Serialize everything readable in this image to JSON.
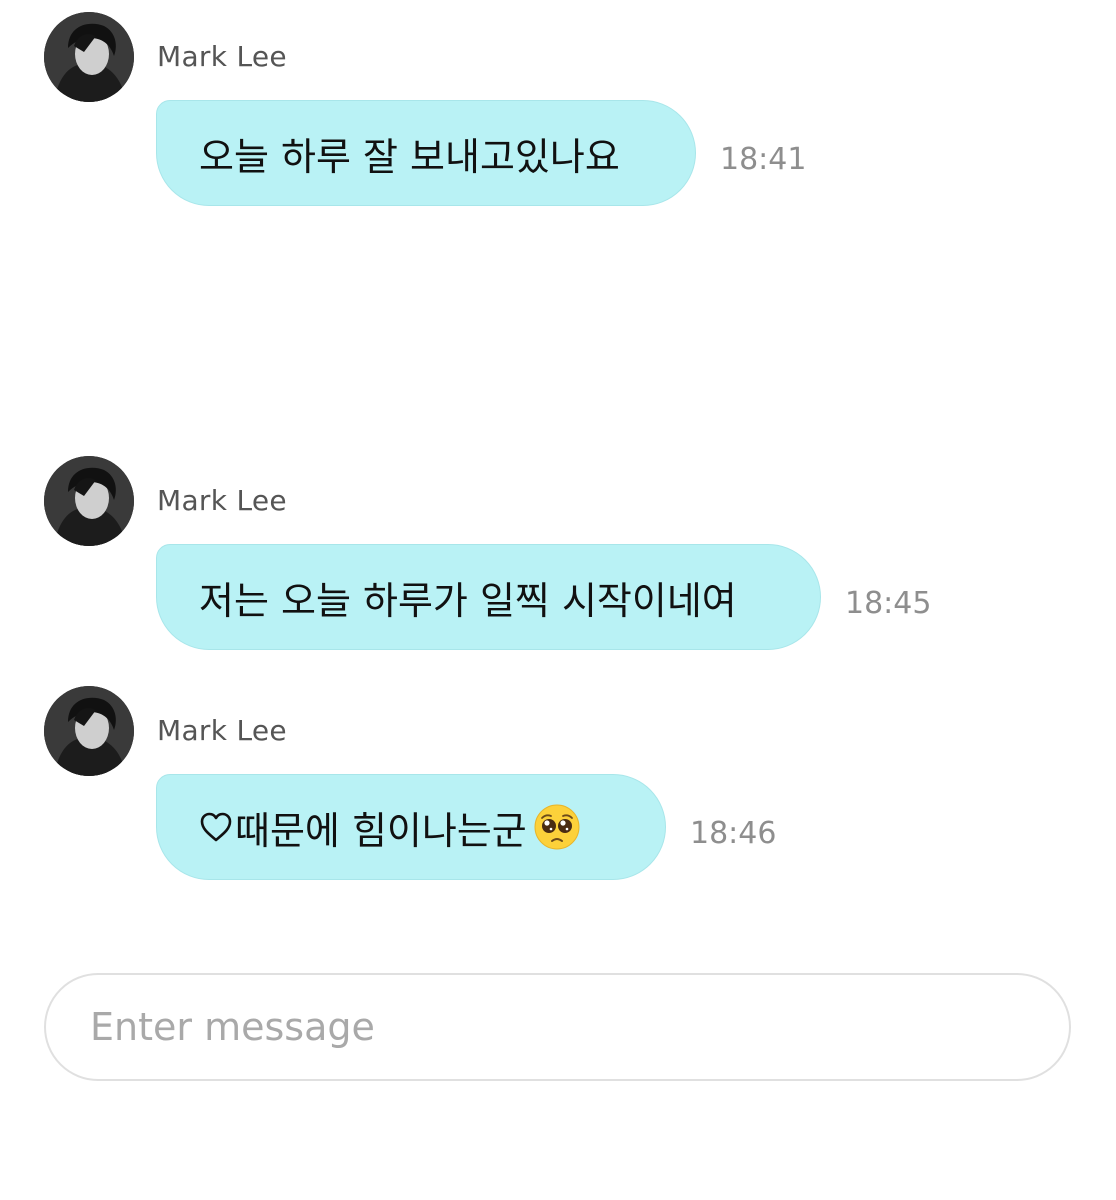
{
  "messages": [
    {
      "sender": "Mark Lee",
      "text": "오늘 하루 잘 보내고있나요",
      "time": "18:41"
    },
    {
      "sender": "Mark Lee",
      "text": "저는 오늘 하루가 일찍 시작이네여",
      "time": "18:45"
    },
    {
      "sender": "Mark Lee",
      "prefix_icon": "heart-outline-icon",
      "text": "때문에 힘이나는군",
      "suffix_icon": "pleading-face-emoji",
      "time": "18:46"
    }
  ],
  "composer": {
    "placeholder": "Enter message",
    "value": ""
  },
  "colors": {
    "bubble": "#b9f2f5",
    "time": "#8e8e8e",
    "sender": "#555555"
  }
}
